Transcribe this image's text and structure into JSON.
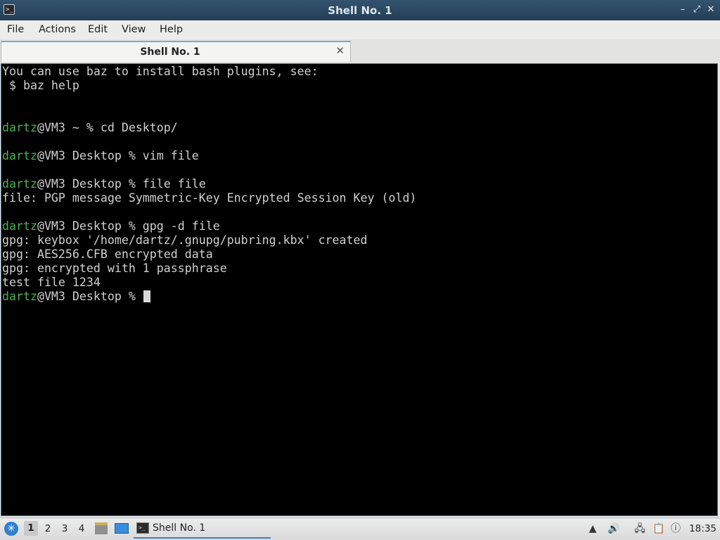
{
  "window": {
    "title": "Shell No. 1",
    "controls": {
      "minimize": "–",
      "restore": "⤢",
      "close": "✕"
    }
  },
  "menu": [
    "File",
    "Actions",
    "Edit",
    "View",
    "Help"
  ],
  "tab": {
    "label": "Shell No. 1",
    "close": "✕"
  },
  "terminal": {
    "lines": [
      {
        "prompt": "",
        "text": "You can use baz to install bash plugins, see:"
      },
      {
        "prompt": "",
        "text": " $ baz help"
      },
      {
        "prompt": "",
        "text": ""
      },
      {
        "prompt": "",
        "text": ""
      },
      {
        "prompt": "dartz",
        "text": "@VM3 ~ % cd Desktop/"
      },
      {
        "prompt": "",
        "text": ""
      },
      {
        "prompt": "dartz",
        "text": "@VM3 Desktop % vim file"
      },
      {
        "prompt": "",
        "text": ""
      },
      {
        "prompt": "dartz",
        "text": "@VM3 Desktop % file file"
      },
      {
        "prompt": "",
        "text": "file: PGP message Symmetric-Key Encrypted Session Key (old)"
      },
      {
        "prompt": "",
        "text": ""
      },
      {
        "prompt": "dartz",
        "text": "@VM3 Desktop % gpg -d file"
      },
      {
        "prompt": "",
        "text": "gpg: keybox '/home/dartz/.gnupg/pubring.kbx' created"
      },
      {
        "prompt": "",
        "text": "gpg: AES256.CFB encrypted data"
      },
      {
        "prompt": "",
        "text": "gpg: encrypted with 1 passphrase"
      },
      {
        "prompt": "",
        "text": "test file 1234"
      },
      {
        "prompt": "dartz",
        "text": "@VM3 Desktop % ",
        "cursor": true
      }
    ]
  },
  "taskbar": {
    "start_icon": "menu-logo-icon",
    "desktops": [
      "1",
      "2",
      "3",
      "4"
    ],
    "active_desktop": "1",
    "task_label": "Shell No. 1",
    "clock": "18:35",
    "tray_icons": [
      "update-icon",
      "volume-icon",
      "network-icon",
      "clipboard-icon",
      "notification-icon"
    ]
  },
  "colors": {
    "prompt_user": "#4caf50",
    "terminal_bg": "#000000",
    "terminal_fg": "#d0d0d0",
    "titlebar": "#2c4a64"
  }
}
